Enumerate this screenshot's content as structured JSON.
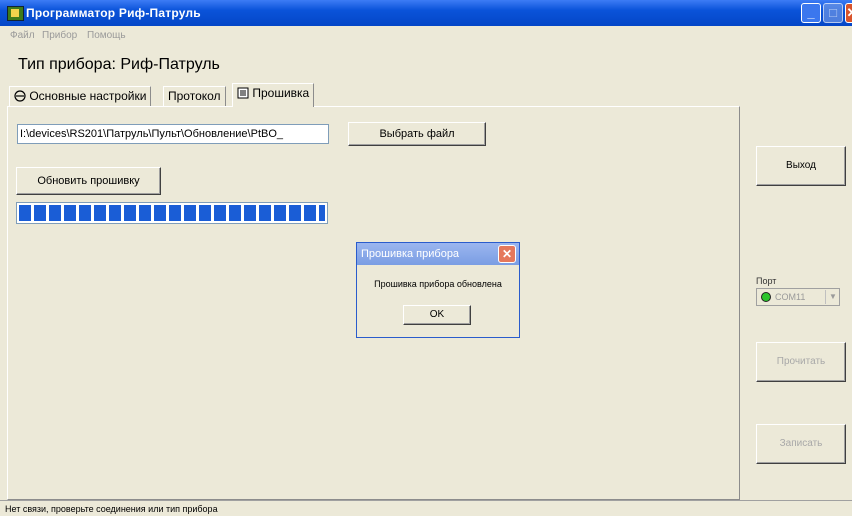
{
  "window": {
    "title": "Программатор Риф-Патруль",
    "controls": {
      "minimize": "_",
      "maximize": "□",
      "close": "✕"
    }
  },
  "menu": [
    "Файл",
    "Прибор",
    "Помощь"
  ],
  "device_title": "Тип прибора: Риф-Патруль",
  "tabs": [
    {
      "label": "Основные настройки",
      "icon": "circle-minus-icon",
      "active": false
    },
    {
      "label": "Протокол",
      "active": false
    },
    {
      "label": "Прошивка",
      "icon": "firmware-icon",
      "active": true
    }
  ],
  "firmware": {
    "file_path": "I:\\devices\\RS201\\Патруль\\Пульт\\Обновление\\PtBO_",
    "choose_file_button": "Выбрать файл",
    "update_button": "Обновить прошивку",
    "progress": 1.0
  },
  "dialog": {
    "title": "Прошивка прибора",
    "message": "Прошивка прибора обновлена",
    "ok_button": "OK",
    "close": "✕"
  },
  "sidebar": {
    "exit_button": "Выход",
    "port_label": "Порт",
    "port_value": "COM11",
    "port_arrow": "▼",
    "read_button": "Прочитать",
    "write_button": "Записать"
  },
  "status_text": "Нет связи, проверьте соединения или тип прибора",
  "colors": {
    "titlebar": "#0a53d9",
    "progress": "#1a5dd6",
    "port_led": "#2cc52c"
  }
}
